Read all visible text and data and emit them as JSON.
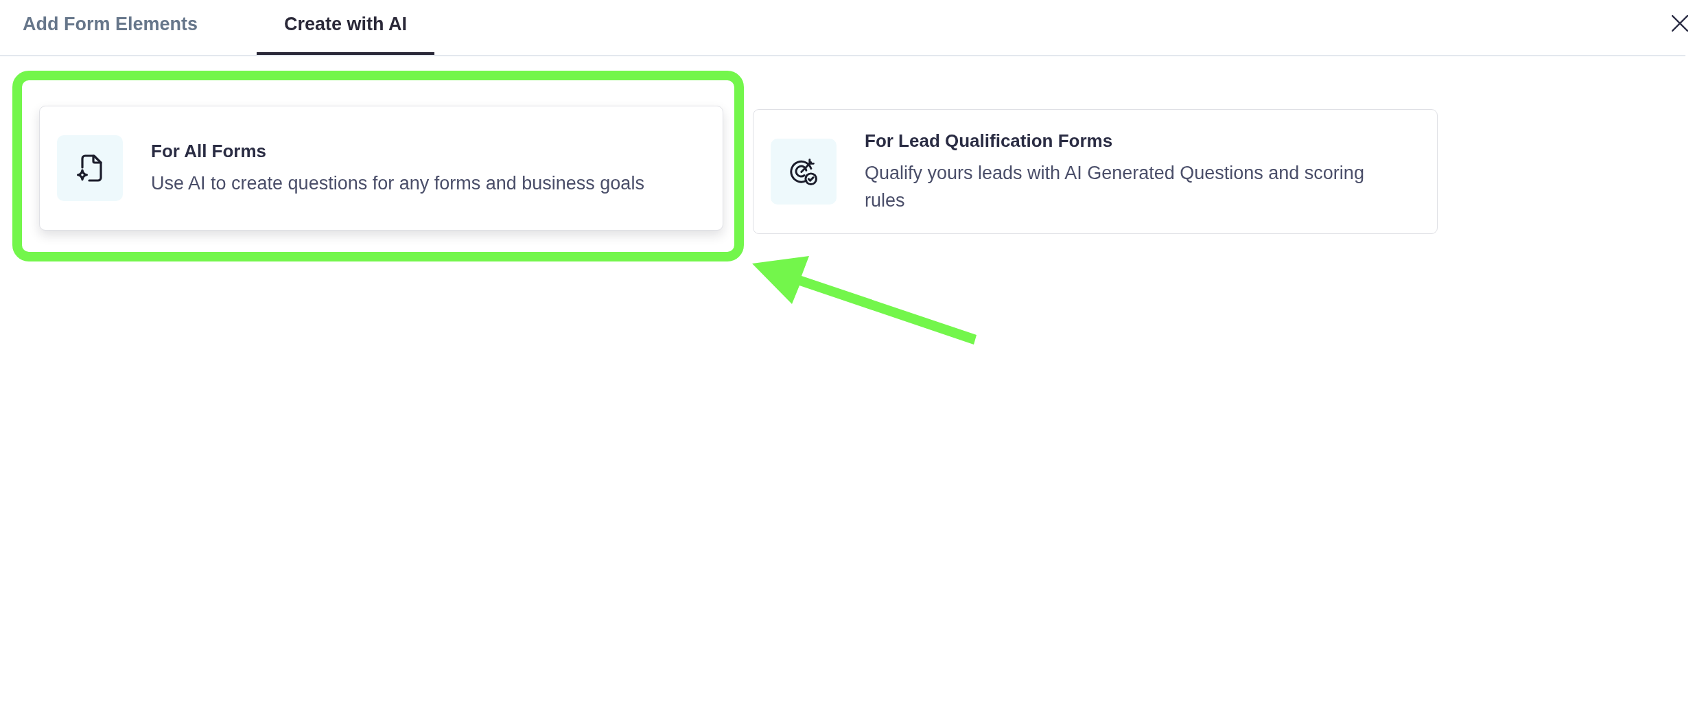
{
  "tabs": [
    {
      "label": "Add Form Elements",
      "selected": false
    },
    {
      "label": "Create with AI",
      "selected": true
    }
  ],
  "options": [
    {
      "kind": "document-sparkle",
      "title": "For All Forms",
      "description": "Use AI to create questions for any forms and business goals",
      "selected": true,
      "highlighted": true
    },
    {
      "kind": "target-check",
      "title": "For Lead Qualification Forms",
      "description": "Qualify yours leads with AI Generated Questions and scoring rules",
      "selected": false,
      "highlighted": false
    }
  ],
  "annotations": [
    {
      "kind": "arrow"
    }
  ]
}
